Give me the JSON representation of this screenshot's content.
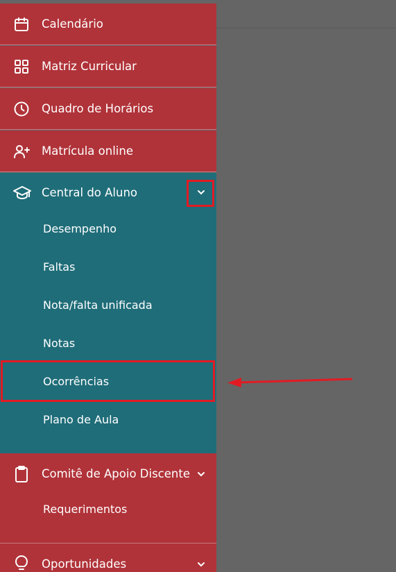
{
  "menu": {
    "calendario": {
      "label": "Calendário",
      "icon": "calendar-icon"
    },
    "matriz": {
      "label": "Matriz Curricular",
      "icon": "grid-icon"
    },
    "quadro": {
      "label": "Quadro de Horários",
      "icon": "clock-icon"
    },
    "matricula": {
      "label": "Matrícula online",
      "icon": "user-plus-icon"
    },
    "central": {
      "label": "Central do Aluno",
      "icon": "graduation-cap-icon",
      "expanded": true,
      "items": [
        "Desempenho",
        "Faltas",
        "Nota/falta unificada",
        "Notas",
        "Ocorrências",
        "Plano de Aula"
      ]
    },
    "comite": {
      "label": "Comitê de Apoio Discente",
      "icon": "clipboard-icon",
      "items": [
        "Requerimentos"
      ]
    },
    "oportunidades": {
      "label": "Oportunidades",
      "icon": "lightbulb-icon"
    }
  },
  "colors": {
    "menu_red": "#b03339",
    "menu_teal": "#1f6d79",
    "highlight": "#e21b23",
    "overlay": "#656565"
  }
}
